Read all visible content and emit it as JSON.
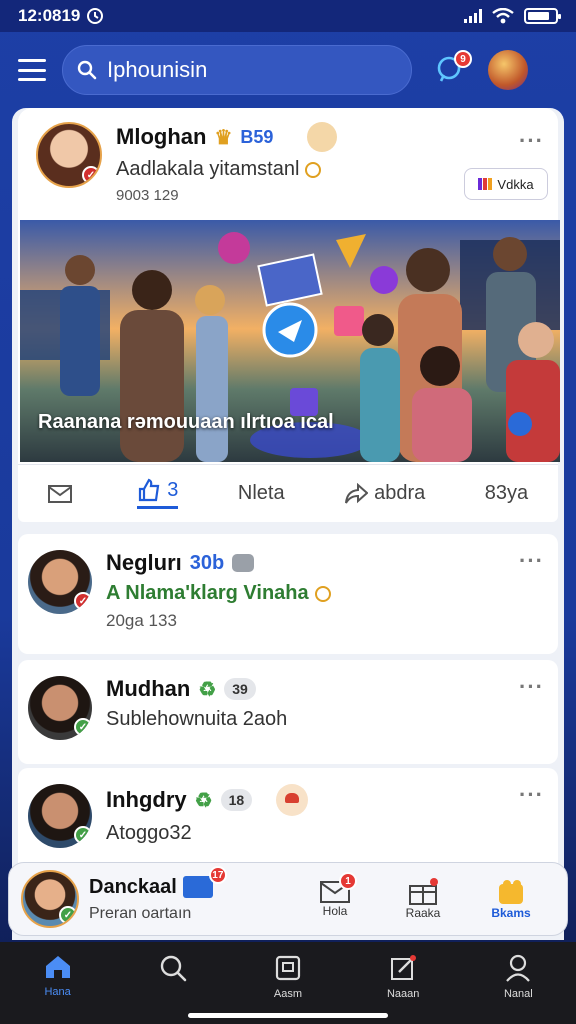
{
  "status": {
    "time": "12:0819"
  },
  "header": {
    "search_text": "Iphounisin",
    "notif_count": "9"
  },
  "post": {
    "name": "Mloghan",
    "name_tag": "B59",
    "subtitle": "Aadlakala yitamstanl",
    "time": "9003 129",
    "button_label": "Vdkka",
    "image_caption": "Raanana rəmouuaan ılrtıoa ıcal",
    "actions": [
      {
        "label": ""
      },
      {
        "label": "3"
      },
      {
        "label": "Nleta"
      },
      {
        "label": "abdra"
      },
      {
        "label": "83ya"
      }
    ]
  },
  "list": [
    {
      "name": "Neglurı",
      "tag": "30b",
      "subtitle": "A Nlama'klarg Vinaha",
      "time": "20ga 133"
    },
    {
      "name": "Mudhan",
      "tag": "39",
      "subtitle": "Sublehownuita 2aoh",
      "time": ""
    },
    {
      "name": "Inhgdry",
      "tag": "18",
      "subtitle": "Atoggo32",
      "time": ""
    }
  ],
  "dock": {
    "name": "Danckaal",
    "subtitle": "Preran oartaın",
    "items": [
      {
        "label": "",
        "badge": "17"
      },
      {
        "label": "Hola",
        "badge": "1"
      },
      {
        "label": "Raaka",
        "badge": ""
      },
      {
        "label": "Bkams",
        "badge": ""
      }
    ]
  },
  "nav": [
    {
      "label": "Hana"
    },
    {
      "label": ""
    },
    {
      "label": "Aasm"
    },
    {
      "label": "Naaan"
    },
    {
      "label": "Nanal"
    }
  ],
  "colors": {
    "accent": "#1e5bd8",
    "header_bg": "#1d3fa6",
    "badge": "#e53935"
  }
}
